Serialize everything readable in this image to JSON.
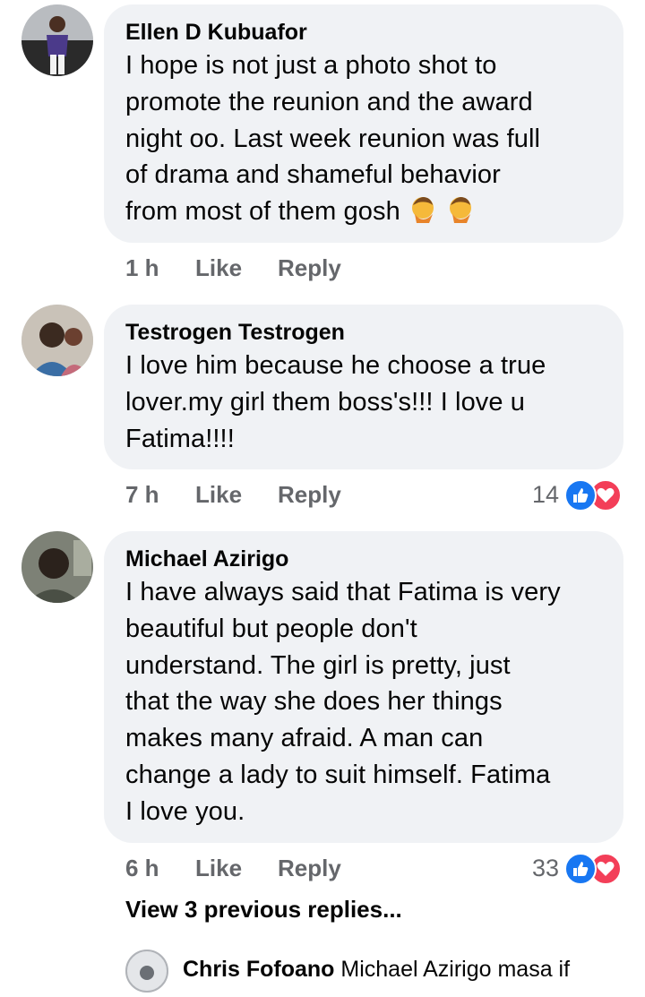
{
  "comments": [
    {
      "author": "Ellen D Kubuafor",
      "lines": [
        "I hope is not just a photo shot to",
        "promote the reunion and the award",
        "night oo. Last week reunion was full",
        "of drama and shameful behavior",
        "from most of them gosh"
      ],
      "emoji": "facepalm-emoji",
      "time": "1 h",
      "like": "Like",
      "reply": "Reply"
    },
    {
      "author": "Testrogen Testrogen",
      "lines": [
        "I love him because he choose a true",
        "lover.my girl them boss's!!!  I love u",
        "Fatima!!!!"
      ],
      "time": "7 h",
      "like": "Like",
      "reply": "Reply",
      "reaction_count": "14",
      "reaction_icons": [
        "like-icon",
        "love-icon"
      ]
    },
    {
      "author": "Michael Azirigo",
      "lines": [
        "I have always said that Fatima is very",
        "beautiful but people don't",
        "understand. The girl is pretty, just",
        "that the way she does her things",
        "makes many afraid. A man can",
        "change a lady to suit himself. Fatima",
        "I love you."
      ],
      "time": "6 h",
      "like": "Like",
      "reply": "Reply",
      "reaction_count": "33",
      "reaction_icons": [
        "like-icon",
        "love-icon"
      ]
    }
  ],
  "view_previous_replies": "View 3 previous replies...",
  "reply_preview": {
    "author": "Chris Fofoano",
    "text": "Michael Azirigo masa if"
  },
  "colors": {
    "bubble": "#f0f2f5",
    "meta_text": "#65676b",
    "like_blue": "#1877f2",
    "love_red": "#f33e58"
  }
}
